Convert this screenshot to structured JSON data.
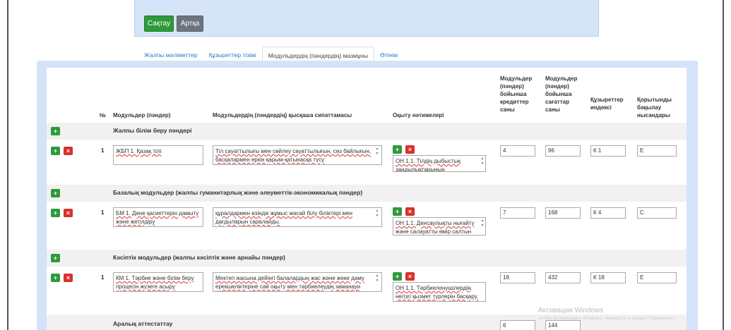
{
  "toolbar": {
    "save_label": "Сақтау",
    "back_label": "Артқа"
  },
  "tabs": [
    "Жалпы мәліметтер",
    "Құзыреттер тізімі",
    "Модульдердің (пәндердің) мазмұны",
    "Өтінім"
  ],
  "columns": {
    "num": "№",
    "module": "Модульдер (пәндер)",
    "desc": "Модульдердің (пәндердің) қысқаша сипаттамасы",
    "outcomes": "Оқыту нәтижелері",
    "credits": "Модульдер (пәндер) бойынша кредиттер саны",
    "hours": "Модульдер (пәндер) бойынша сағаттар саны",
    "comp": "Құзыреттер индексі",
    "control": "Қорытынды бақылау нысандары"
  },
  "sections": [
    {
      "title": "Жалпы білім беру пәндері",
      "row": {
        "num": "1",
        "module": "ЖБП 1.  Қазақ тілі",
        "desc": "Тіл сауаттылығы мен сөйлеу сауаттылығын, сөз байлығын, басқалармен еркін қарым-қатынасқа түсу",
        "outcome": "ОН 1.1. Тілдің дыбыстық заңдылықтарының",
        "credits": "4",
        "hours": "96",
        "comp": "К 1",
        "control": "Е"
      }
    },
    {
      "title": "Базалық модульдер (жалпы гуманитарлық және әлеуметтік-экономикалық пәндер)",
      "row": {
        "num": "1",
        "module": "БМ 1. Дене қасиеттерін дамыту және жетілдіру",
        "desc": "құралдармен өзіндік жұмыс жасай білу біліктері мен дағдыларын саралайды.",
        "outcome": "ОН 1.1. Денсаулықты нығайту және салауатты өмір салтын",
        "credits": "7",
        "hours": "168",
        "comp": "К 4",
        "control": "С"
      }
    },
    {
      "title": "Кәсіптік модульдер (жалпы кәсіптік және арнайы пәндер)",
      "row": {
        "num": "1",
        "module": "КМ 1. Тәрбие және білім беру процесін жүзеге асыру",
        "desc": "Мектеп жасына дейінгі балалардың жас және жеке даму ерекшеліктеріне сай оқыту мен тәрбиелеудің заманауи",
        "outcome": "ОН 1.1. Тәрбиеленушілердің негізгі қызмет түрлерін басқару.",
        "credits": "18",
        "hours": "432",
        "comp": "К 18",
        "control": "Е"
      }
    }
  ],
  "attestation": {
    "title": "Аралық аттестаттау",
    "credits": "6",
    "hours": "144"
  },
  "watermark": {
    "title": "Активация Windows",
    "subtitle": "Чтобы активировать Windows, перейдите в раздел \"Параметры\"."
  }
}
